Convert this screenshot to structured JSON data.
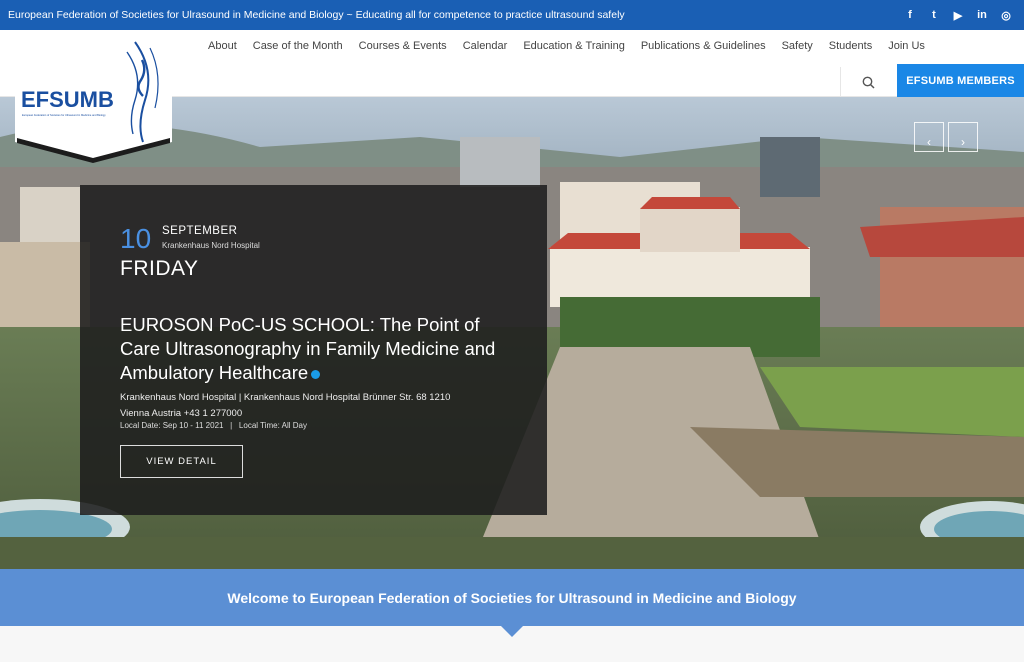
{
  "topbar": {
    "tagline": "European Federation of Societies for Ulrasound in Medicine and Biology ~ Educating all for competence to practice ultrasound safely",
    "socials": [
      {
        "icon": "facebook-icon",
        "glyph": "f"
      },
      {
        "icon": "twitter-icon",
        "glyph": "t"
      },
      {
        "icon": "youtube-icon",
        "glyph": "▶"
      },
      {
        "icon": "linkedin-icon",
        "glyph": "in"
      },
      {
        "icon": "instagram-icon",
        "glyph": "◎"
      }
    ]
  },
  "logo": {
    "name": "EFSUMB",
    "subtitle": "European Federation of Societies for Ultrasound in Medicine and Biology"
  },
  "nav": {
    "items": [
      "About",
      "Case of the Month",
      "Courses & Events",
      "Calendar",
      "Education & Training",
      "Publications & Guidelines",
      "Safety",
      "Students",
      "Join Us"
    ]
  },
  "header": {
    "members_label": "EFSUMB MEMBERS",
    "search_icon": "search-icon"
  },
  "hero": {
    "prev_glyph": "‹",
    "next_glyph": "›",
    "event": {
      "day": "10",
      "month": "SEPTEMBER",
      "venue_short": "Krankenhaus Nord Hospital",
      "weekday": "FRIDAY",
      "title": "EUROSON PoC-US SCHOOL: The Point of Care Ultrasonography in Family Medicine and Ambulatory Healthcare",
      "address_line1": "Krankenhaus Nord Hospital | Krankenhaus Nord Hospital Brünner Str. 68 1210",
      "address_line2": "Vienna Austria +43 1 277000",
      "local_date": "Local Date: Sep 10 - 11 2021",
      "local_time": "Local Time: All Day",
      "detail_label": "VIEW DETAIL"
    }
  },
  "welcome": {
    "text": "Welcome to European Federation of Societies for Ultrasound in Medicine and Biology"
  },
  "colors": {
    "topbar": "#1a5fb4",
    "accent": "#1a87e6",
    "welcome": "#5b8fd4"
  }
}
